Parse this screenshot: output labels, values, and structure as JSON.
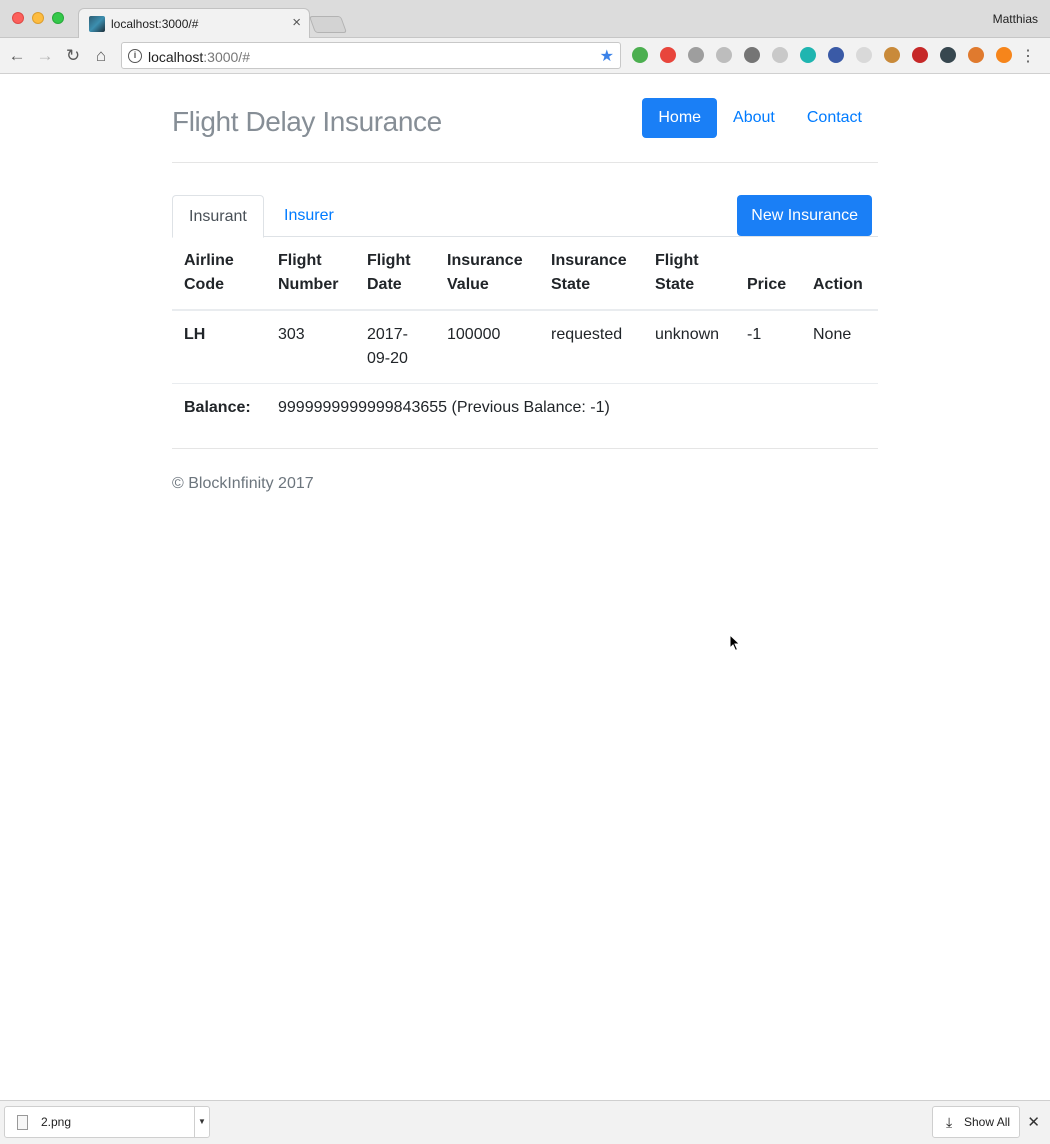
{
  "browser": {
    "tab_title": "localhost:3000/#",
    "tab_close": "×",
    "profile_name": "Matthias",
    "url_host": "localhost",
    "url_rest": ":3000/#",
    "back_icon": "←",
    "forward_icon": "→",
    "reload_icon": "↻",
    "home_icon": "⌂",
    "star_icon": "★",
    "menu_icon": "⋮",
    "extensions": [
      {
        "name": "ext-green-icon",
        "color": "#4caf50"
      },
      {
        "name": "ext-chrome-icon",
        "color": "#e8453c"
      },
      {
        "name": "ext-eye-icon",
        "color": "#9e9e9e"
      },
      {
        "name": "ext-reader-icon",
        "color": "#bdbdbd"
      },
      {
        "name": "ext-link-icon",
        "color": "#757575"
      },
      {
        "name": "ext-grid-icon",
        "color": "#c9c9c9"
      },
      {
        "name": "ext-m-icon",
        "color": "#1fb5b0"
      },
      {
        "name": "ext-z-icon",
        "color": "#3a5aa6"
      },
      {
        "name": "ext-puzzle-icon",
        "color": "#d9d9d9"
      },
      {
        "name": "ext-cookie-icon",
        "color": "#c98a3a"
      },
      {
        "name": "ext-a-icon",
        "color": "#c62828"
      },
      {
        "name": "ext-circle-icon",
        "color": "#37474f"
      },
      {
        "name": "ext-off-icon",
        "color": "#e07a2e"
      },
      {
        "name": "ext-metamask-icon",
        "color": "#f6851b"
      }
    ]
  },
  "header": {
    "brand": "Flight Delay Insurance",
    "nav": [
      "Home",
      "About",
      "Contact"
    ]
  },
  "tabs": {
    "insurant": "Insurant",
    "insurer": "Insurer",
    "new_button": "New Insurance"
  },
  "table": {
    "headers": [
      [
        "Airline",
        "Code"
      ],
      [
        "Flight",
        "Number"
      ],
      [
        "Flight",
        "Date"
      ],
      [
        "Insurance",
        "Value"
      ],
      [
        "Insurance",
        "State"
      ],
      [
        "Flight",
        "State"
      ],
      [
        "Price",
        ""
      ],
      [
        "Action",
        ""
      ]
    ],
    "rows": [
      {
        "airline": "LH",
        "flight_number": "303",
        "flight_date_1": "2017-",
        "flight_date_2": "09-20",
        "insurance_value": "100000",
        "insurance_state": "requested",
        "flight_state": "unknown",
        "price": "-1",
        "action": "None"
      }
    ],
    "balance_label": "Balance:",
    "balance_value": "9999999999999843655 (Previous Balance: -1)"
  },
  "footer": {
    "text": "© BlockInfinity 2017"
  },
  "downloads": {
    "file_name": "2.png",
    "show_all": "Show All",
    "close_icon": "✕"
  }
}
